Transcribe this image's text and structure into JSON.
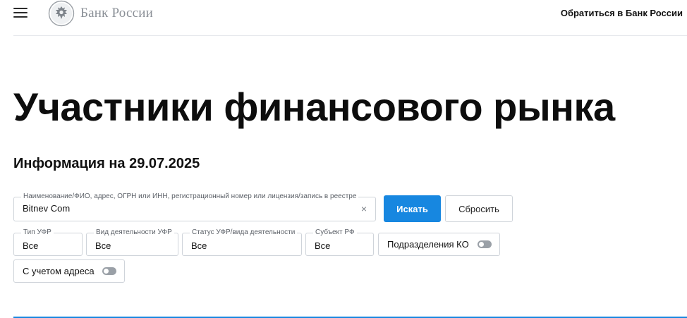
{
  "header": {
    "logo_text": "Банк России",
    "contact_link": "Обратиться в Банк России"
  },
  "page": {
    "title": "Участники финансового рынка",
    "info_date": "Информация на 29.07.2025"
  },
  "search": {
    "label": "Наименование/ФИО, адрес, ОГРН или ИНН, регистрационный номер или лицензия/запись в реестре",
    "value": "Bitnev Com",
    "clear_symbol": "×",
    "search_button": "Искать",
    "reset_button": "Сбросить"
  },
  "filters": {
    "ufr_type": {
      "label": "Тип УФР",
      "value": "Все"
    },
    "activity_type": {
      "label": "Вид деятельности УФР",
      "value": "Все"
    },
    "status": {
      "label": "Статус УФР/вида деятельности",
      "value": "Все"
    },
    "subject": {
      "label": "Субъект РФ",
      "value": "Все"
    },
    "ko_divisions": {
      "label": "Подразделения КО",
      "enabled": false
    },
    "with_address": {
      "label": "С учетом адреса",
      "enabled": false
    }
  },
  "colors": {
    "accent": "#1787e0",
    "border": "#cfd4da",
    "toggle_off": "#9aa0a7"
  },
  "icons": {
    "menu": "hamburger-menu-icon",
    "logo": "bank-emblem-icon",
    "clear": "clear-icon"
  }
}
